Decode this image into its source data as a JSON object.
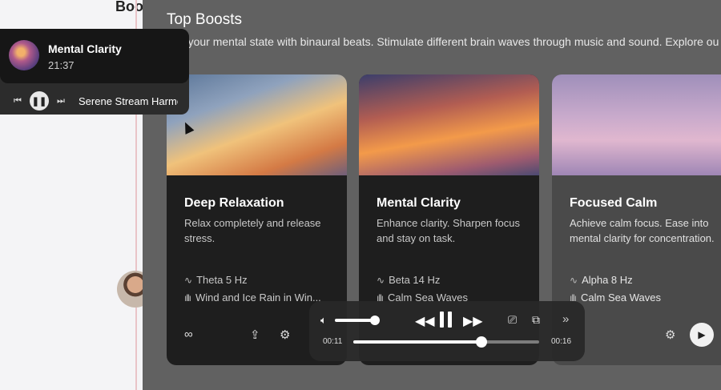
{
  "page": {
    "title_partial": "Boo"
  },
  "section": {
    "title": "Top Boosts",
    "description": "Elevate your mental state with binaural beats. Stimulate different brain waves through music and sound. Explore ou"
  },
  "cards": [
    {
      "title": "Deep Relaxation",
      "description": "Relax completely and release stress.",
      "frequency": "Theta 5 Hz",
      "track": "Wind and Ice Rain in Win..."
    },
    {
      "title": "Mental Clarity",
      "description": "Enhance clarity. Sharpen focus and stay on task.",
      "frequency": "Beta 14 Hz",
      "track": "Calm Sea Waves"
    },
    {
      "title": "Focused Calm",
      "description": "Achieve calm focus. Ease into mental clarity for concentration.",
      "frequency": "Alpha 8 Hz",
      "track": "Calm Sea Waves"
    }
  ],
  "mini_player": {
    "title": "Mental Clarity",
    "time": "21:37",
    "track": "Serene Stream Harmony"
  },
  "video_controls": {
    "elapsed": "00:11",
    "remaining": "00:16",
    "progress": 0.69,
    "volume": 0.85
  },
  "icons": {
    "wave": "waveform-icon",
    "infinity": "infinity-icon",
    "share": "share-icon",
    "settings": "sliders-icon"
  }
}
